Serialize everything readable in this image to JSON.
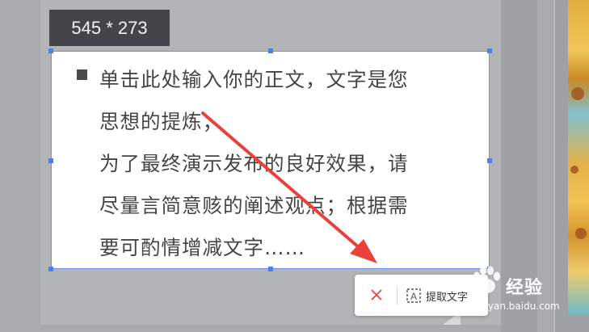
{
  "size_badge": {
    "text": "545 * 273"
  },
  "textbox": {
    "lines": [
      "单击此处输入你的正文，文字是您",
      "思想的提炼；",
      "为了最终演示发布的良好效果，请",
      "尽量言简意赅的阐述观点；根据需",
      "要可酌情增减文字……"
    ]
  },
  "toolbar": {
    "close_icon": "close-icon",
    "extract_icon": "text-extract-icon",
    "extract_label": "提取文字"
  },
  "watermark": {
    "title": "经验",
    "url": "jingyan.baidu.com",
    "icon": "paw-icon"
  },
  "colors": {
    "annotation_arrow": "#e8403b",
    "selection_border": "#6f90e8",
    "badge_bg": "#42464b"
  }
}
